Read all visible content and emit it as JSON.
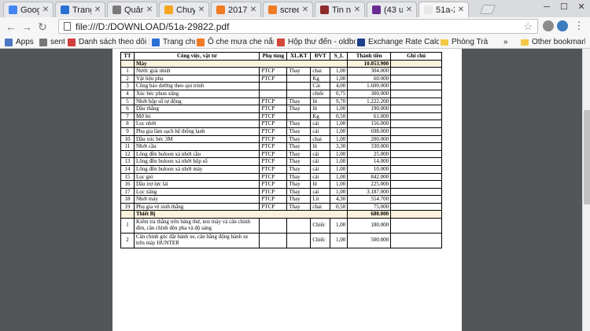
{
  "tabs": [
    {
      "title": "Google",
      "color": "#4285f4"
    },
    {
      "title": "Trang c",
      "color": "#2a6fd6"
    },
    {
      "title": "Quản c",
      "color": "#7a7a7a"
    },
    {
      "title": "Chuyê",
      "color": "#f5a623"
    },
    {
      "title": "2017t",
      "color": "#f07b22"
    },
    {
      "title": "screen",
      "color": "#f07b22"
    },
    {
      "title": "Tin nh",
      "color": "#8e2b2b"
    },
    {
      "title": "(43 un",
      "color": "#6a2c91"
    },
    {
      "title": "51a-29",
      "color": "#e8e8e8"
    }
  ],
  "window": {
    "minimize": "─",
    "maximize": "☐",
    "close": "✕"
  },
  "toolbar": {
    "back": "←",
    "forward": "→",
    "reload": "↻",
    "url": "file:///D:/DOWNLOAD/51a-29822.pdf",
    "star": "☆",
    "menu": "⋮"
  },
  "bookmarks": [
    {
      "label": "Apps",
      "color": "#4a76c4"
    },
    {
      "label": "sent",
      "color": "#777777"
    },
    {
      "label": "Danh sách theo dõi |",
      "color": "#d23d3d"
    },
    {
      "label": "Trang chủ",
      "color": "#2a6fd6"
    },
    {
      "label": "Ô che mưa che nắng c",
      "color": "#f07b22"
    },
    {
      "label": "Hộp thư đến - oldboy",
      "color": "#d44638"
    },
    {
      "label": "Exchange Rate Calcul",
      "color": "#1f3f8f"
    },
    {
      "label": "Phòng Trà",
      "color": "#f4c945"
    },
    {
      "label": "»",
      "color": ""
    },
    {
      "label": "Other bookmarks",
      "color": "#f4c945"
    }
  ],
  "table": {
    "headers": [
      "TT",
      "Công việc, vật tư",
      "Phụ tùng",
      "XL.KT",
      "ĐVT",
      "S_L",
      "Thành tiền",
      "Ghi chú"
    ],
    "section1": {
      "label": "Máy",
      "total": "10.053.900"
    },
    "rows1": [
      [
        "1",
        "Nước giải nhiệt",
        "PTCP",
        "Thay",
        "chai",
        "1,00",
        "304.000",
        ""
      ],
      [
        "2",
        "Vật liệu phụ",
        "PTCP",
        "",
        "Kg",
        "1,00",
        "60.000",
        ""
      ],
      [
        "3",
        "Công bảo dưỡng theo qui trình",
        "",
        "",
        "Cái",
        "4,00",
        "1.600.000",
        ""
      ],
      [
        "4",
        "Xúc béc phun xăng",
        "",
        "",
        "chiếc",
        "0,75",
        "300.000",
        ""
      ],
      [
        "5",
        "Nhớt hộp số tự động",
        "PTCP",
        "Thay",
        "lít",
        "9,70",
        "1.222.200",
        ""
      ],
      [
        "6",
        "Dầu thắng",
        "PTCP",
        "Thay",
        "lít",
        "1,00",
        "190.000",
        ""
      ],
      [
        "7",
        "Mỡ bò",
        "PTCP",
        "",
        "Kg",
        "0,50",
        "61.000",
        ""
      ],
      [
        "8",
        "Lọc nhớt",
        "PTCP",
        "Thay",
        "cái",
        "1,00",
        "156.000",
        ""
      ],
      [
        "9",
        "Phụ gia làm sạch hệ thống lạnh",
        "PTCP",
        "Thay",
        "cái",
        "1,00",
        "698.000",
        ""
      ],
      [
        "10",
        "Dầu xúc béc 3M",
        "PTCP",
        "Thay",
        "chai",
        "1,00",
        "200.000",
        ""
      ],
      [
        "11",
        "Nhớt cầu",
        "PTCP",
        "Thay",
        "lít",
        "3,30",
        "330.000",
        ""
      ],
      [
        "12",
        "Lông đền buloon xả nhớt cầu",
        "PTCP",
        "Thay",
        "cái",
        "1,00",
        "25.000",
        ""
      ],
      [
        "13",
        "Lông đền buloon xả nhớt hộp số",
        "PTCP",
        "Thay",
        "cái",
        "1,00",
        "14.000",
        ""
      ],
      [
        "14",
        "Lông đền buloon xả nhớt máy",
        "PTCP",
        "Thay",
        "cái",
        "1,00",
        "10.000",
        ""
      ],
      [
        "15",
        "Lọc gió",
        "PTCP",
        "Thay",
        "cái",
        "1,00",
        "842.000",
        ""
      ],
      [
        "16",
        "Dầu trợ lực lái",
        "PTCP",
        "Thay",
        "lít",
        "1,00",
        "225.000",
        ""
      ],
      [
        "17",
        "Lọc xăng",
        "PTCP",
        "Thay",
        "cái",
        "1,00",
        "3.187.000",
        ""
      ],
      [
        "18",
        "Nhớt máy",
        "PTCP",
        "Thay",
        "Lít",
        "4,30",
        "554.700",
        ""
      ],
      [
        "19",
        "Phụ gia vệ sinh thắng",
        "PTCP",
        "Thay",
        "chai",
        "0,50",
        "75.000",
        ""
      ]
    ],
    "section2": {
      "label": "Thiết Bị",
      "total": "680.000"
    },
    "rows2": [
      [
        "1",
        "Kiểm tra thắng trên băng thử, test máy và cân chỉnh đèn, cân chỉnh đèn pha và độ sáng",
        "",
        "",
        "Chiếc",
        "1,00",
        "180.000",
        ""
      ],
      [
        "2",
        "Cân chỉnh góc đặt bánh xe, cân bằng động bánh xe trên máy HUNTER",
        "",
        "",
        "Chiếc",
        "1,00",
        "500.000",
        ""
      ]
    ]
  }
}
